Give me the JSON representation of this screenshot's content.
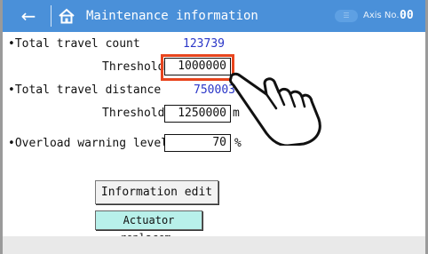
{
  "header": {
    "back_icon": "arrow-left-icon",
    "home_icon": "home-icon",
    "title": "Maintenance information",
    "axis_label": "Axis No.",
    "axis_number": "00",
    "color": "#4a90d9"
  },
  "main": {
    "travel_count_label": "•Total travel count",
    "travel_count_value": "123739",
    "count_threshold_label": "Threshold",
    "count_threshold_value": "1000000",
    "travel_distance_label": "•Total travel distance",
    "travel_distance_value": "750003",
    "distance_threshold_label": "Threshold",
    "distance_threshold_value": "1250000",
    "distance_unit": "m",
    "overload_label": "•Overload warning level",
    "overload_value": "70",
    "overload_unit": "%",
    "value_color": "#2a36c8",
    "highlight_color": "#e8451e"
  },
  "buttons": {
    "info_edit": "Information edit",
    "actuator_replace": "Actuator replacem."
  },
  "overlay": {
    "pointer_icon": "pointing-hand-icon"
  }
}
